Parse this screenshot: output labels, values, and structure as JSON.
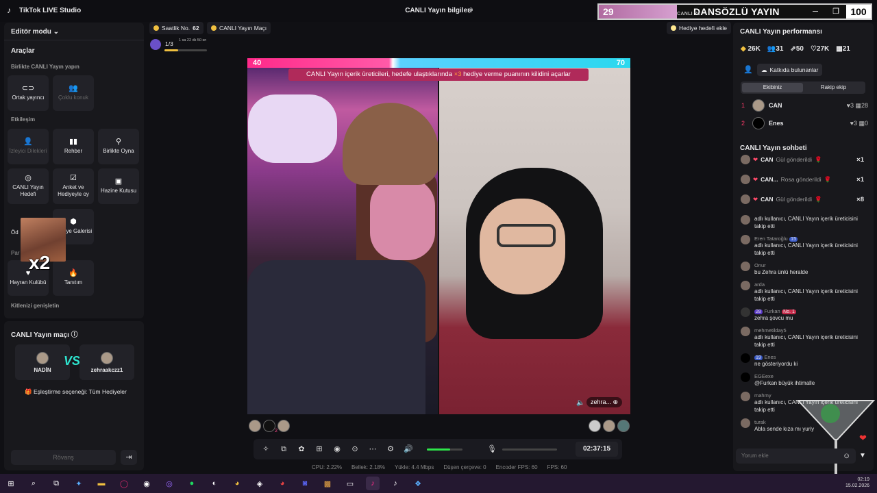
{
  "app": {
    "title": "TikTok LIVE Studio",
    "center_title": "CANLI Yayın bilgileri"
  },
  "overlay": {
    "left_value": "29",
    "title": "DANSÖZLÜ YAYIN",
    "small_text": "CANLI Ya",
    "right_value": "100"
  },
  "left": {
    "editor_mode": "Editör modu",
    "tools_title": "Araçlar",
    "together_title": "Birlikte CANLI Yayın yapın",
    "cohost": "Ortak yayıncı",
    "multi_guest": "Çoklu konuk",
    "interaction_title": "Etkileşim",
    "viewer_requests": "İzleyici Dilekleri",
    "guide": "Rehber",
    "play_together": "Birlikte Oyna",
    "live_goal": "CANLI Yayın Hedefi",
    "poll": "Anket ve Hediyeyle oy",
    "treasure": "Hazine Kutusu",
    "gift_gallery": "Hediye Galerisi",
    "od_partial": "Öd",
    "pa_partial": "Par",
    "fan_club": "Hayran Kulübü",
    "promo": "Tanıtım",
    "audience_title": "Kitlenizi genişletin",
    "meme_text": "x2"
  },
  "match": {
    "title": "CANLI Yayın maçı",
    "player1": "NADİN",
    "player2": "zehraakczz1",
    "vs": "VS",
    "pairing": "Eşleştirme seçeneği: Tüm Hediyeler",
    "rematch": "Rövanş"
  },
  "top": {
    "hourly_label": "Saatlik No.",
    "hourly_value": "62",
    "match_label": "CANLI Yayın Maçı",
    "goal_label": "Hediye hedefi ekle",
    "progress_fraction": "1/3",
    "progress_time": "1 sa 22 dk 50 sn",
    "progress_level": 0.33
  },
  "battle": {
    "score_left": "40",
    "score_right": "70",
    "banner_text": "CANLI Yayın içerik üreticileri, hedefe ulaştıklarında",
    "banner_mult": "×3",
    "banner_end": "hediye verme puanının kilidini açarlar",
    "name_tag": "zehra...",
    "left_rank": "2"
  },
  "controls": {
    "timer": "02:37:15",
    "volume_level": 0.65
  },
  "stats": {
    "cpu": "CPU: 2.22%",
    "mem": "Bellek: 2.18%",
    "upload": "Yükle: 4.4 Mbps",
    "drop": "Düşen çerçeve: 0",
    "enc": "Encoder FPS: 60",
    "fps": "FPS: 60"
  },
  "right": {
    "perf_title": "CANLI Yayın performansı",
    "perf": [
      "26K",
      "31",
      "50",
      "27K",
      "21"
    ],
    "contributors": "Katkıda bulunanlar",
    "tab_team": "Ekibiniz",
    "tab_rival": "Rakip ekip",
    "ranks": [
      {
        "n": "1",
        "name": "CAN",
        "hearts": "3",
        "gifts": "28"
      },
      {
        "n": "2",
        "name": "Enes",
        "hearts": "3",
        "gifts": "0"
      }
    ],
    "chat_title": "CANLI Yayın sohbeti",
    "gifts": [
      {
        "user": "CAN",
        "text": "Gül gönderildi",
        "count": "×1"
      },
      {
        "user": "CAN...",
        "text": "Rosa gönderildi",
        "count": "×1"
      },
      {
        "user": "CAN",
        "text": "Gül gönderildi",
        "count": "×8"
      }
    ],
    "chat": [
      {
        "user": "",
        "text": "adlı kullanıcı, CANLI Yayın içerik üreticisini takip etti"
      },
      {
        "user": "Eren Tataroğlu",
        "badge": "15",
        "text": "adlı kullanıcı, CANLI Yayın içerik üreticisini takip etti"
      },
      {
        "user": "Onur",
        "text": "bu Zehra ünlü heralde"
      },
      {
        "user": "arda",
        "text": "adlı kullanıcı, CANLI Yayın içerik üreticisini takip etti"
      },
      {
        "user": "Furkan",
        "badge": "28",
        "rank": "No. 1",
        "text": "zehra şovcu mu"
      },
      {
        "user": "mehmetilday5",
        "text": "adlı kullanıcı, CANLI Yayın içerik üreticisini takip etti"
      },
      {
        "user": "Enes",
        "badge": "19",
        "text": "ne gösteriyordu ki"
      },
      {
        "user": "EGEexe",
        "text": "@Furkan büyük ihtimalle"
      },
      {
        "user": "mahmy",
        "text": "adlı kullanıcı, CANLI Yayın içerik üreticisini takip etti"
      },
      {
        "user": "turak",
        "text": "Abla sende kıza mı yuriy"
      }
    ],
    "comment_placeholder": "Yorum ekle"
  },
  "taskbar": {
    "time": "02:19",
    "date": "15.02.2026"
  },
  "colors": {
    "accent": "#ff2a8a",
    "rival": "#2ad8ee",
    "banner": "#b02a5a"
  }
}
